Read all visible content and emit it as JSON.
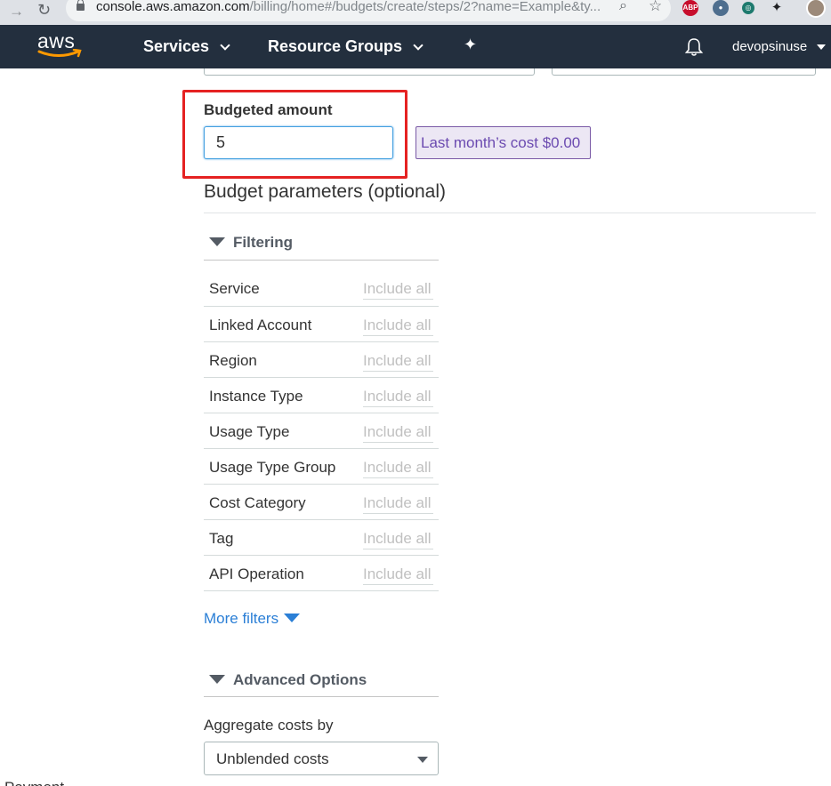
{
  "browser": {
    "url_host": "console.aws.amazon.com",
    "url_path": "/billing/home#/budgets/create/steps/2?name=Example&ty...",
    "extension_abp": "ABP"
  },
  "aws_nav": {
    "logo_text": "aws",
    "services_label": "Services",
    "resource_groups_label": "Resource Groups",
    "username": "devopsinuse"
  },
  "budget": {
    "label": "Budgeted amount",
    "amount": "5",
    "last_month_cost": "Last month’s cost $0.00"
  },
  "parameters": {
    "title": "Budget parameters (optional)"
  },
  "filtering": {
    "title": "Filtering",
    "placeholder": "Include all",
    "filters": [
      "Service",
      "Linked Account",
      "Region",
      "Instance Type",
      "Usage Type",
      "Usage Type Group",
      "Cost Category",
      "Tag",
      "API Operation"
    ],
    "more_filters": "More filters"
  },
  "advanced": {
    "title": "Advanced Options",
    "aggregate_label": "Aggregate costs by",
    "aggregate_value": "Unblended costs"
  },
  "left_rail": {
    "cut_label": "Payment"
  },
  "colors": {
    "nav_bg": "#232f3e",
    "highlight": "#e52222",
    "link": "#2b7fd6",
    "last_month_bg": "#ece7f4"
  }
}
